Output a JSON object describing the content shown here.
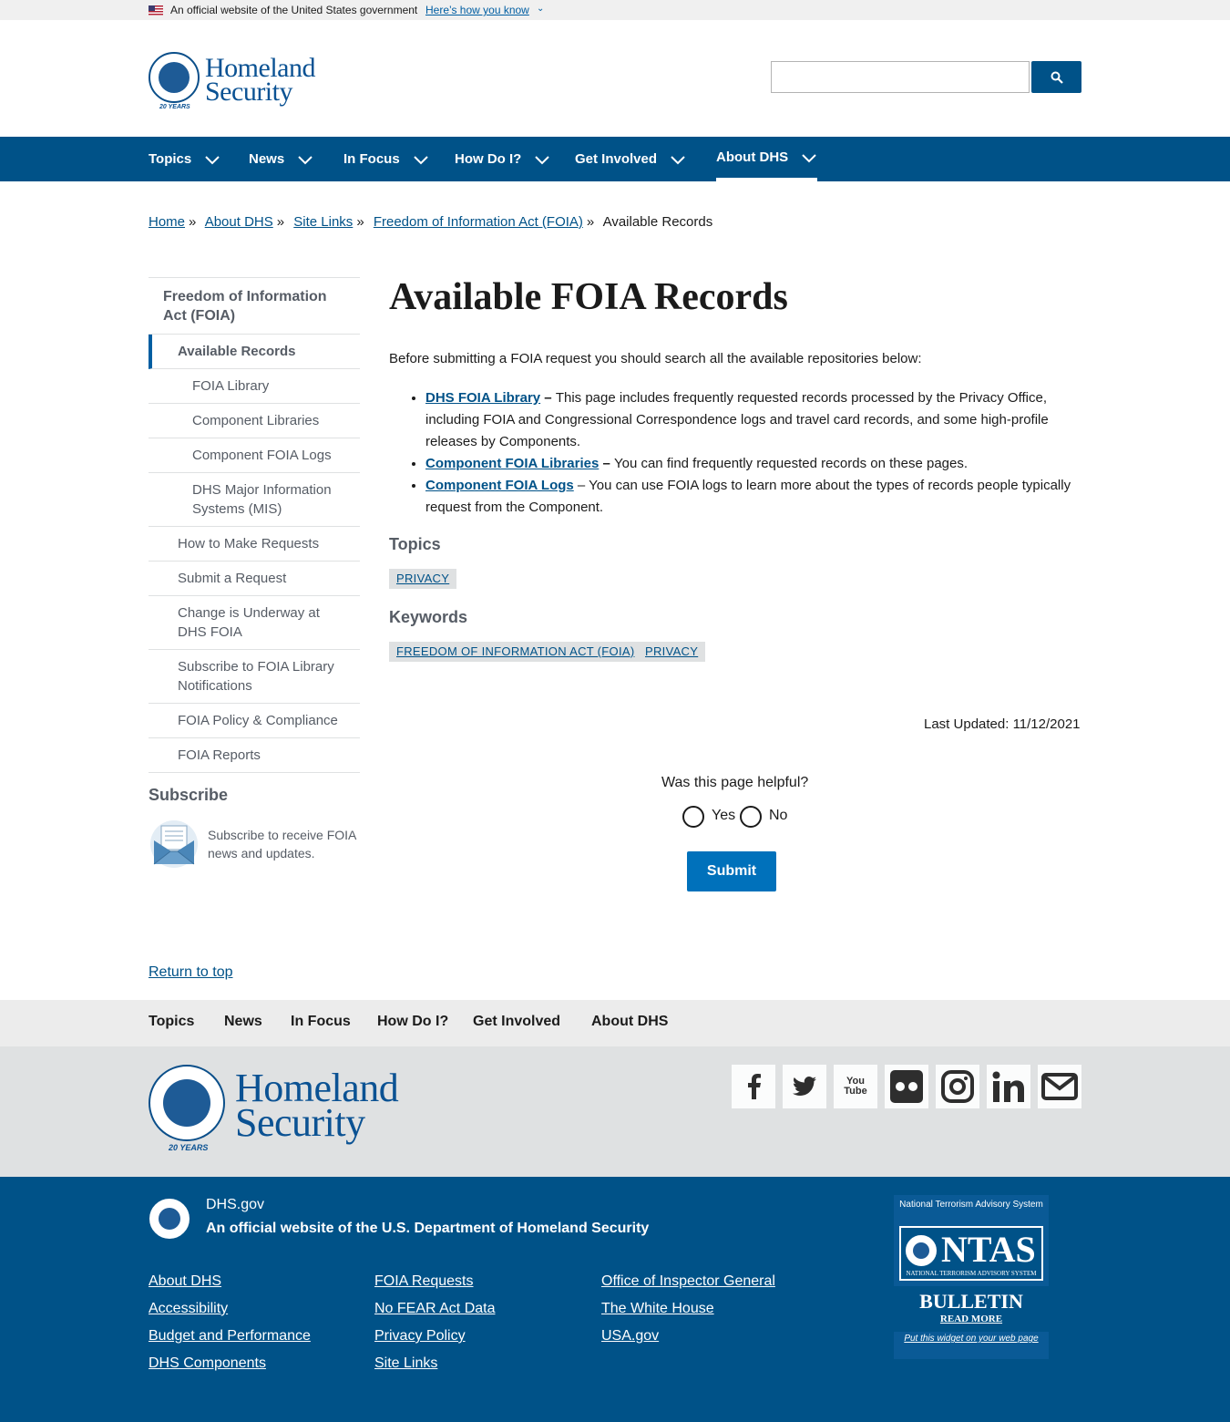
{
  "gov_banner": {
    "official": "An official website of the United States government",
    "how_know": "Here’s how you know"
  },
  "logo": {
    "line1": "Homeland",
    "line2": "Security",
    "seal_years": "20 YEARS"
  },
  "search": {
    "placeholder": "",
    "button_icon": "search-icon"
  },
  "nav": [
    "Topics",
    "News",
    "In Focus",
    "How Do I?",
    "Get Involved",
    "About DHS"
  ],
  "breadcrumb": {
    "items": [
      "Home",
      "About DHS",
      "Site Links",
      "Freedom of Information Act (FOIA)"
    ],
    "current": "Available Records",
    "sep": "»"
  },
  "sidenav": {
    "parent": "Freedom of Information Act (FOIA)",
    "current": "Available Records",
    "children": [
      "FOIA Library",
      "Component Libraries",
      "Component FOIA Logs",
      "DHS Major Information Systems (MIS)"
    ],
    "siblings": [
      "How to Make Requests",
      "Submit a Request",
      "Change is Underway at DHS FOIA",
      "Subscribe to FOIA Library Notifications",
      "FOIA Policy & Compliance",
      "FOIA Reports"
    ]
  },
  "subscribe": {
    "heading": "Subscribe",
    "text": "Subscribe to receive FOIA news and updates."
  },
  "main": {
    "title": "Available FOIA Records",
    "intro": "Before submitting a FOIA request you should search all the available repositories below:",
    "items": [
      {
        "link": "DHS FOIA Library",
        "sep": " – ",
        "text": "This page includes frequently requested records processed by the Privacy Office, including FOIA and Congressional Correspondence logs and travel card records, and some high-profile releases by Components."
      },
      {
        "link": "Component FOIA Libraries",
        "sep": " – ",
        "text": "You can find frequently requested records on these pages."
      },
      {
        "link": "Component FOIA Logs",
        "sep": " – ",
        "text": "You can use FOIA logs to learn more about the types of records people typically request from the Component."
      }
    ],
    "topics_heading": "Topics",
    "topics": [
      "PRIVACY"
    ],
    "keywords_heading": "Keywords",
    "keywords": [
      "FREEDOM OF INFORMATION ACT (FOIA)",
      "PRIVACY"
    ],
    "last_updated": "Last Updated: 11/12/2021"
  },
  "feedback": {
    "question": "Was this page helpful?",
    "yes": "Yes",
    "no": "No",
    "submit": "Submit"
  },
  "return_top": "Return to top",
  "footer_nav": [
    "Topics",
    "News",
    "In Focus",
    "How Do I?",
    "Get Involved",
    "About DHS"
  ],
  "social": [
    "facebook-icon",
    "twitter-icon",
    "youtube-icon",
    "flickr-icon",
    "instagram-icon",
    "linkedin-icon",
    "email-icon"
  ],
  "youtube_label": "You Tube",
  "footer": {
    "site": "DHS.gov",
    "official_prefix": "An official website of the",
    "official_link": "U.S. Department of Homeland Security",
    "col1": [
      "About DHS",
      "Accessibility",
      "Budget and Performance",
      "DHS Components"
    ],
    "col2": [
      "FOIA Requests",
      "No FEAR Act Data",
      "Privacy Policy",
      "Site Links"
    ],
    "col3": [
      "Office of Inspector General",
      "The White House",
      "USA.gov"
    ]
  },
  "ntas": {
    "title": "National Terrorism Advisory System",
    "logo": "NTAS",
    "logo_sub": "NATIONAL TERRORISM ADVISORY SYSTEM",
    "bulletin": "BULLETIN",
    "read_more": "READ MORE",
    "widget": "Put this widget on your web page"
  },
  "colors": {
    "primary": "#005288",
    "link": "#005288",
    "submit": "#0071bb",
    "footer_nav_bg": "#ececec",
    "footer_mid_bg": "#dfe1e2"
  }
}
